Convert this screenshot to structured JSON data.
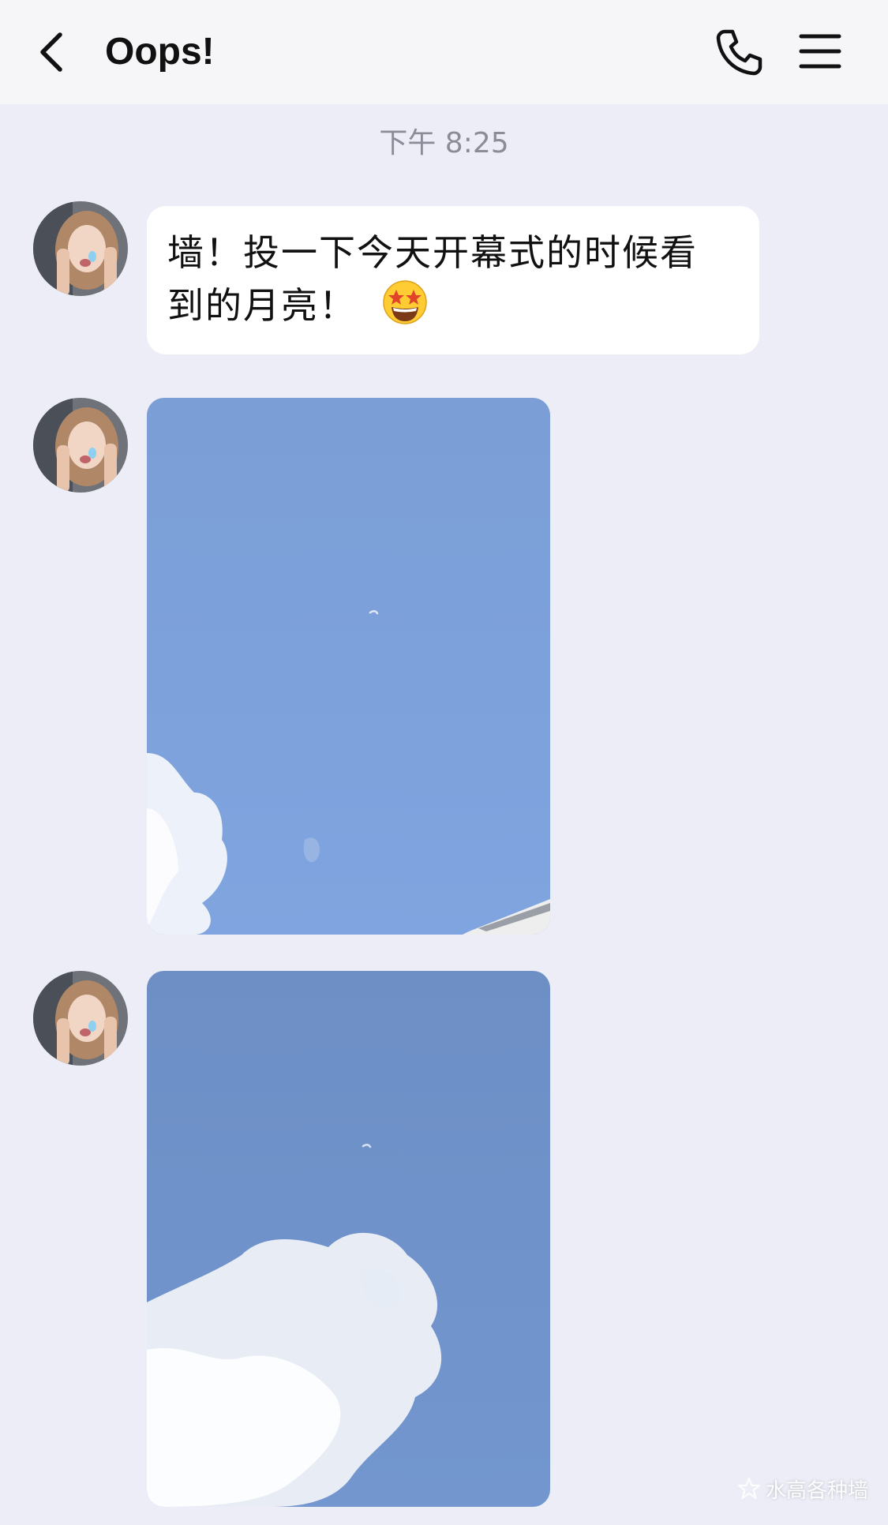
{
  "header": {
    "title": "Oops!",
    "back_icon": "chevron-left-icon",
    "call_icon": "phone-icon",
    "menu_icon": "menu-icon"
  },
  "chat": {
    "timestamp": "下午 8:25",
    "messages": [
      {
        "type": "text",
        "text_line1": "墙！投一下今天开幕式的时候看",
        "text_line2": "到的月亮！",
        "emoji": "star-struck-emoji"
      },
      {
        "type": "image",
        "description_icon": "sky-photo-1"
      },
      {
        "type": "image",
        "description_icon": "sky-photo-2"
      }
    ]
  },
  "watermark": {
    "text": "水高各种墙",
    "icon": "star-logo-icon"
  },
  "colors": {
    "background": "#ecedf7",
    "header_bg": "#f6f6f8",
    "bubble_bg": "#ffffff",
    "timestamp_text": "#8a8c98",
    "sky_blue": "#7b9fd8"
  }
}
